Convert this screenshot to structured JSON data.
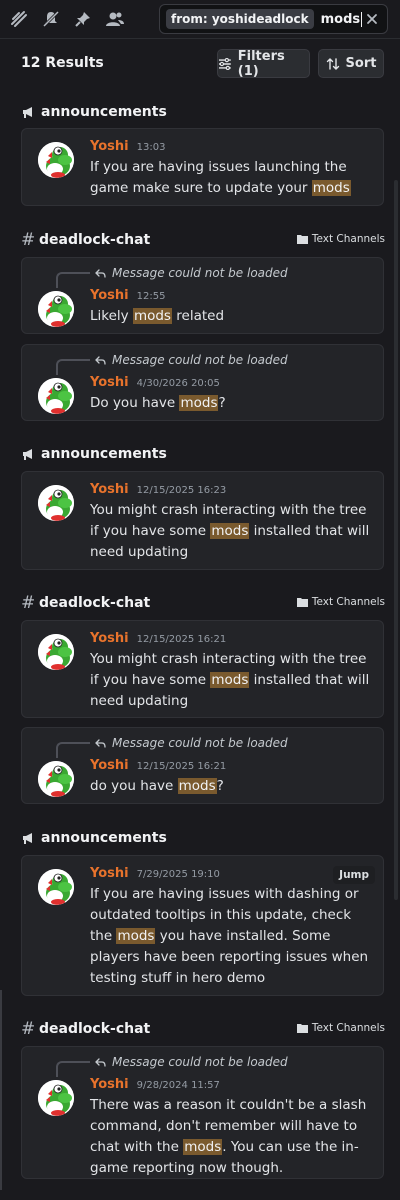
{
  "toolbar": {
    "icons": [
      "threads-icon",
      "mute-icon",
      "pin-icon",
      "members-icon"
    ]
  },
  "search": {
    "filter_chip": "from: yoshideadlock",
    "query": "mods"
  },
  "results": {
    "count_label": "12 Results",
    "filters_label": "Filters (1)",
    "sort_label": "Sort"
  },
  "groups": [
    {
      "channel": "announcements",
      "kind": "announcement",
      "category": "",
      "messages": [
        {
          "reply": "",
          "author": "Yoshi",
          "time": "13:03",
          "text": [
            [
              "If you are having issues launching the game make sure to update your ",
              false
            ],
            [
              "mods",
              true
            ]
          ]
        }
      ]
    },
    {
      "channel": "deadlock-chat",
      "kind": "text",
      "category": "Text Channels",
      "messages": [
        {
          "reply": "Message could not be loaded",
          "author": "Yoshi",
          "time": "12:55",
          "text": [
            [
              "Likely ",
              false
            ],
            [
              "mods",
              true
            ],
            [
              " related",
              false
            ]
          ]
        },
        {
          "reply": "Message could not be loaded",
          "author": "Yoshi",
          "time": "4/30/2026 20:05",
          "text": [
            [
              "Do you have ",
              false
            ],
            [
              "mods",
              true
            ],
            [
              "?",
              false
            ]
          ]
        }
      ]
    },
    {
      "channel": "announcements",
      "kind": "announcement",
      "category": "",
      "messages": [
        {
          "reply": "",
          "author": "Yoshi",
          "time": "12/15/2025 16:23",
          "text": [
            [
              "You might crash interacting with the tree if you have some ",
              false
            ],
            [
              "mods",
              true
            ],
            [
              " installed that will need updating",
              false
            ]
          ]
        }
      ]
    },
    {
      "channel": "deadlock-chat",
      "kind": "text",
      "category": "Text Channels",
      "messages": [
        {
          "reply": "",
          "author": "Yoshi",
          "time": "12/15/2025 16:21",
          "text": [
            [
              "You might crash interacting with the tree if you have some ",
              false
            ],
            [
              "mods",
              true
            ],
            [
              " installed that will need updating",
              false
            ]
          ]
        },
        {
          "reply": "Message could not be loaded",
          "author": "Yoshi",
          "time": "12/15/2025 16:21",
          "text": [
            [
              "do you have ",
              false
            ],
            [
              "mods",
              true
            ],
            [
              "?",
              false
            ]
          ]
        }
      ]
    },
    {
      "channel": "announcements",
      "kind": "announcement",
      "category": "",
      "messages": [
        {
          "reply": "",
          "author": "Yoshi",
          "time": "7/29/2025 19:10",
          "jump": "Jump",
          "text": [
            [
              "If you are having issues with dashing or outdated tooltips in this update, check the ",
              false
            ],
            [
              "mods",
              true
            ],
            [
              " you have installed. Some players have been reporting issues when testing stuff in hero demo",
              false
            ]
          ]
        }
      ]
    },
    {
      "channel": "deadlock-chat",
      "kind": "text",
      "category": "Text Channels",
      "messages": [
        {
          "reply": "Message could not be loaded",
          "author": "Yoshi",
          "time": "9/28/2024 11:57",
          "text": [
            [
              "There was a reason it couldn't be a slash command, don't remember will have to chat with the ",
              false
            ],
            [
              "mods",
              true
            ],
            [
              ". You can use the in-game reporting now though.",
              false
            ]
          ]
        }
      ]
    }
  ]
}
